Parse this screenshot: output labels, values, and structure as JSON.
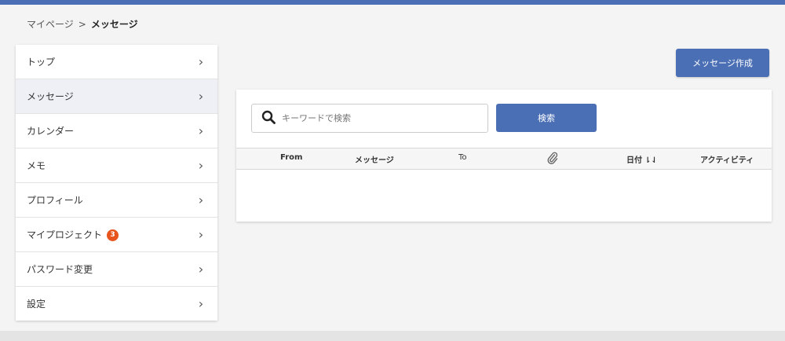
{
  "breadcrumb": {
    "parent": "マイページ",
    "separator": ">",
    "current": "メッセージ"
  },
  "sidebar": {
    "items": [
      {
        "label": "トップ"
      },
      {
        "label": "メッセージ"
      },
      {
        "label": "カレンダー"
      },
      {
        "label": "メモ"
      },
      {
        "label": "プロフィール"
      },
      {
        "label": "マイプロジェクト",
        "badge": "3"
      },
      {
        "label": "パスワード変更"
      },
      {
        "label": "設定"
      }
    ],
    "chevron": "›",
    "active_item": "メッセージ"
  },
  "toolbar": {
    "create_label": "メッセージ作成"
  },
  "search": {
    "placeholder": "キーワードで検索",
    "button_label": "検索"
  },
  "table": {
    "columns": {
      "from": "From",
      "message": "メッセージ",
      "to": "To",
      "attachment_icon": "paperclip-icon",
      "date": "日付",
      "date_sort_icon": "sort-desc-icon",
      "activity": "アクティビティ"
    },
    "rows": []
  },
  "colors": {
    "accent": "#4b6fb5",
    "badge": "#e8541d",
    "active_bg": "#eef0f6"
  }
}
